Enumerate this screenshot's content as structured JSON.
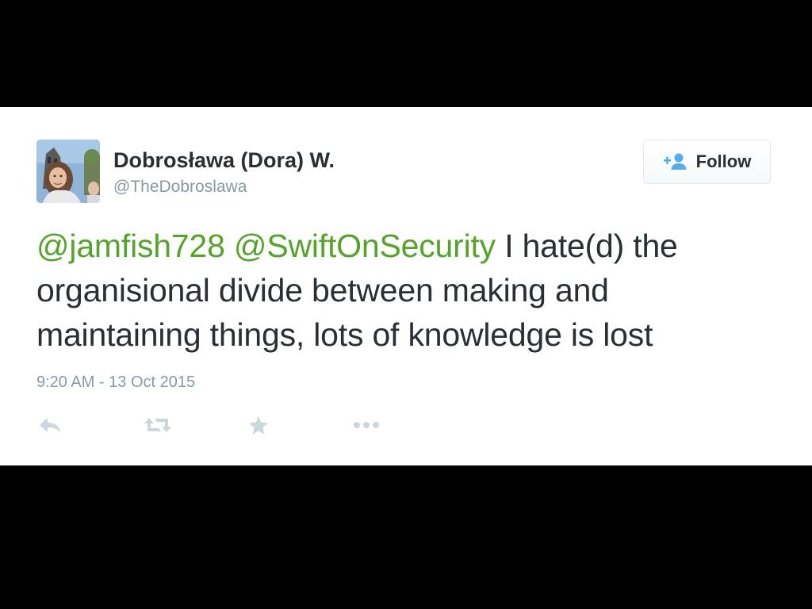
{
  "tweet": {
    "author": {
      "display_name": "Dobrosława (Dora) W.",
      "screen_name": "@TheDobroslawa",
      "avatar_icon": "profile-photo"
    },
    "follow_button": {
      "label": "Follow",
      "icon": "add-user-icon"
    },
    "text": {
      "mention_1": "@jamfish728",
      "mention_2": "@SwiftOnSecurity",
      "body": "I hate(d) the organisional divide between making and maintaining things, lots of knowledge is lost"
    },
    "timestamp": "9:20 AM - 13 Oct 2015",
    "actions": [
      {
        "name": "reply",
        "icon": "reply-icon"
      },
      {
        "name": "retweet",
        "icon": "retweet-icon"
      },
      {
        "name": "favorite",
        "icon": "star-icon"
      },
      {
        "name": "more",
        "icon": "more-dots-icon"
      }
    ]
  },
  "colors": {
    "mention": "#55a32a",
    "accent_blue": "#55acee",
    "text_dark": "#292f33",
    "text_muted": "#8899a6",
    "action_gray": "#ccd6dd",
    "letterbox": "#000000"
  }
}
